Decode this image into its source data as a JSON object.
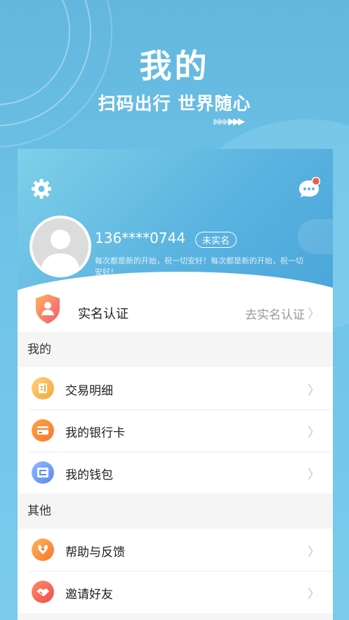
{
  "hero": {
    "title": "我的",
    "subtitle": "扫码出行 世界随心"
  },
  "profile": {
    "phone": "136****0744",
    "status_badge": "未实名",
    "motto": "每次都是新的开始，祝一切安好！每次都是新的开始，祝一切安好！",
    "settings_icon": "gear-icon",
    "message_icon": "chat-bubble-icon"
  },
  "verify": {
    "label": "实名认证",
    "action": "去实名认证"
  },
  "sections": {
    "mine": {
      "title": "我的",
      "items": [
        {
          "label": "交易明细",
          "icon": "receipt-icon"
        },
        {
          "label": "我的银行卡",
          "icon": "bank-card-icon"
        },
        {
          "label": "我的钱包",
          "icon": "wallet-icon"
        }
      ]
    },
    "other": {
      "title": "其他",
      "items": [
        {
          "label": "帮助与反馈",
          "icon": "help-icon"
        },
        {
          "label": "邀请好友",
          "icon": "handshake-icon"
        }
      ]
    }
  },
  "colors": {
    "accent": "#5bb4e0",
    "badge_red": "#f25b4e"
  }
}
